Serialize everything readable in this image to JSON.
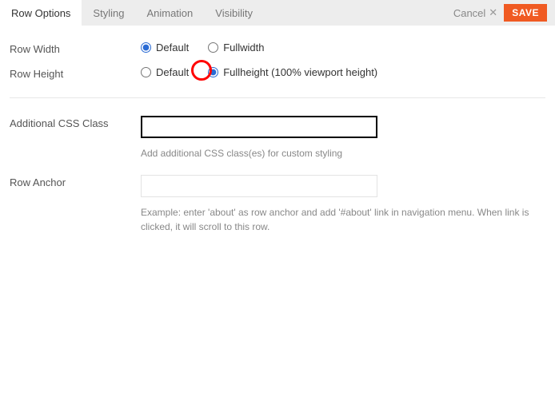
{
  "tabs": {
    "row_options": "Row Options",
    "styling": "Styling",
    "animation": "Animation",
    "visibility": "Visibility"
  },
  "actions": {
    "cancel": "Cancel",
    "save": "SAVE"
  },
  "fields": {
    "row_width": {
      "label": "Row Width",
      "option_default": "Default",
      "option_fullwidth": "Fullwidth"
    },
    "row_height": {
      "label": "Row Height",
      "option_default": "Default",
      "option_fullheight": "Fullheight (100% viewport height)"
    },
    "css_class": {
      "label": "Additional CSS Class",
      "value": "",
      "help": "Add additional CSS class(es) for custom styling"
    },
    "row_anchor": {
      "label": "Row Anchor",
      "value": "",
      "help": "Example: enter 'about' as row anchor and add '#about' link in navigation menu. When link is clicked, it will scroll to this row."
    }
  },
  "annotation": {
    "circle_on": "row-height-fullheight-radio"
  }
}
